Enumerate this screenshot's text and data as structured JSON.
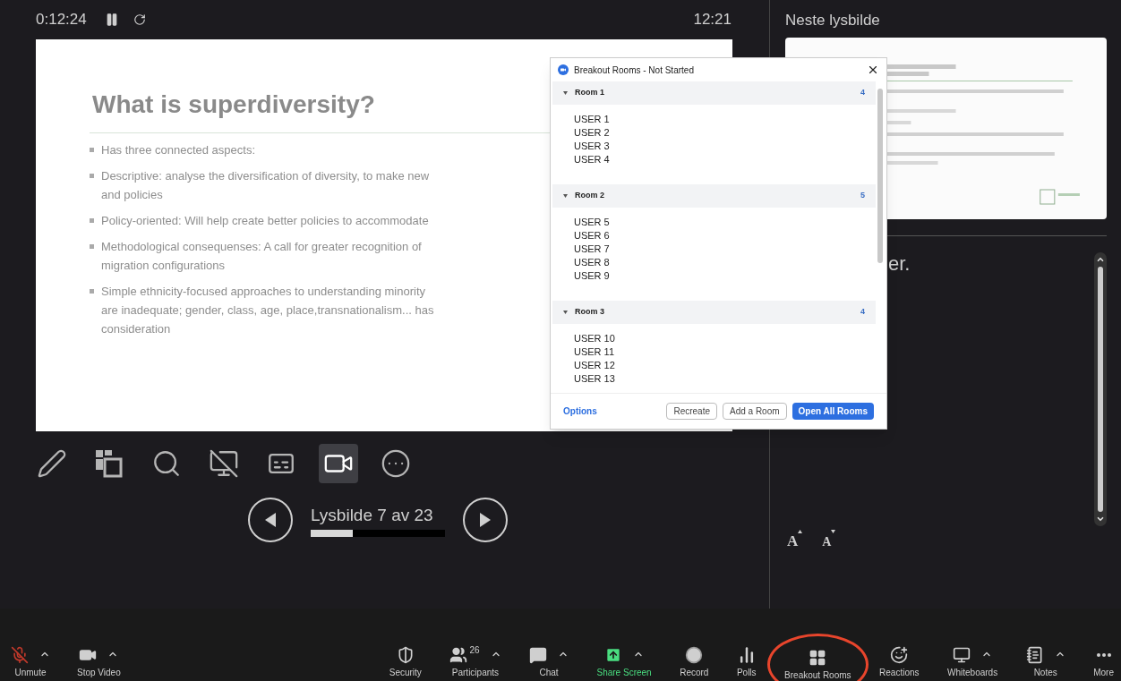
{
  "presenter": {
    "timer": "0:12:24",
    "clock": "12:21",
    "slide": {
      "title": "What is superdiversity?",
      "bullets": [
        {
          "lines": [
            "Has three connected aspects:"
          ]
        },
        {
          "lines": [
            "Descriptive: analyse the diversification of diversity, to make new",
            "and policies"
          ]
        },
        {
          "lines": [
            "Policy-oriented: Will help create better policies to accommodate"
          ]
        },
        {
          "lines": [
            "Methodological consequenses: A call for greater recognition of",
            "migration configurations"
          ]
        },
        {
          "lines": [
            "Simple ethnicity-focused approaches to understanding minority",
            "are inadequate; gender, class, age, place,transnationalism... has",
            "consideration"
          ]
        }
      ]
    },
    "tools": [
      {
        "kind": "pen",
        "selected": false
      },
      {
        "kind": "layout",
        "selected": false
      },
      {
        "kind": "zoom",
        "selected": false
      },
      {
        "kind": "screen-off",
        "selected": false
      },
      {
        "kind": "subtitles",
        "selected": false
      },
      {
        "kind": "camera",
        "selected": true
      },
      {
        "kind": "more",
        "selected": false
      }
    ],
    "slide_counter": "Lysbilde 7 av 23",
    "progress": {
      "level": 0.31
    }
  },
  "next_slide": {
    "heading": "Neste lysbilde",
    "kind": "picture"
  },
  "notes": {
    "text": "er."
  },
  "font_size_buttons": [
    {
      "label": "A",
      "kind": "increase"
    },
    {
      "label": "A",
      "kind": "decrease"
    }
  ],
  "dialog": {
    "title": "Breakout Rooms - Not Started",
    "rooms": [
      {
        "name": "Room 1",
        "count": "4",
        "expanded": true,
        "users": [
          "USER 1",
          "USER 2",
          "USER 3",
          "USER 4"
        ]
      },
      {
        "name": "Room 2",
        "count": "5",
        "expanded": true,
        "users": [
          "USER 5",
          "USER 6",
          "USER 7",
          "USER 8",
          "USER 9"
        ]
      },
      {
        "name": "Room 3",
        "count": "4",
        "expanded": true,
        "users": [
          "USER 10",
          "USER 11",
          "USER 12",
          "USER 13"
        ]
      }
    ],
    "options": "Options",
    "buttons": [
      {
        "label": "Recreate",
        "primary": false
      },
      {
        "label": "Add a Room",
        "primary": false
      },
      {
        "label": "Open All Rooms",
        "primary": true
      }
    ]
  },
  "toolbar": {
    "left": [
      {
        "label": "Unmute",
        "kind": "mic-muted",
        "caret": true
      },
      {
        "label": "Stop Video",
        "kind": "video",
        "caret": true
      }
    ],
    "right": [
      {
        "label": "Security",
        "kind": "shield",
        "caret": false,
        "highlighted": false
      },
      {
        "label": "Participants",
        "kind": "participants",
        "badge": "26",
        "caret": true,
        "highlighted": false
      },
      {
        "label": "Chat",
        "kind": "chat",
        "caret": true,
        "highlighted": false
      },
      {
        "label": "Share Screen",
        "kind": "share",
        "caret": true,
        "highlighted": false
      },
      {
        "label": "Record",
        "kind": "record",
        "caret": false,
        "highlighted": false
      },
      {
        "label": "Polls",
        "kind": "polls",
        "caret": false,
        "highlighted": false
      },
      {
        "label": "Breakout Rooms",
        "kind": "breakout",
        "caret": false,
        "highlighted": true
      },
      {
        "label": "Reactions",
        "kind": "reactions",
        "caret": false,
        "highlighted": false
      },
      {
        "label": "Whiteboards",
        "kind": "whiteboard",
        "caret": true,
        "highlighted": false
      },
      {
        "label": "Notes",
        "kind": "notes",
        "caret": true,
        "highlighted": false
      },
      {
        "label": "More",
        "kind": "more",
        "caret": false,
        "highlighted": false
      }
    ]
  }
}
